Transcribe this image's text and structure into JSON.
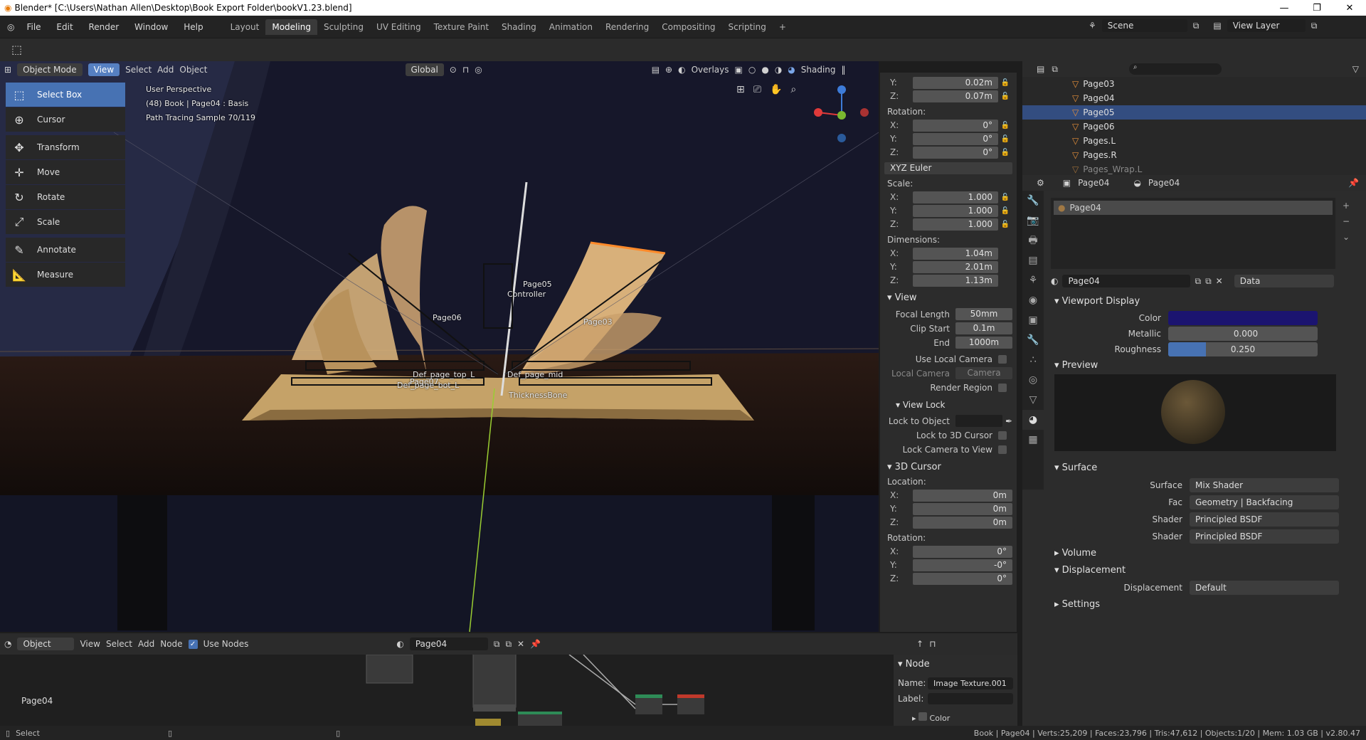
{
  "titlebar": {
    "text": "Blender* [C:\\Users\\Nathan Allen\\Desktop\\Book Export Folder\\bookV1.23.blend]",
    "minimize": "—",
    "maximize": "❐",
    "close": "✕"
  },
  "menus": [
    "File",
    "Edit",
    "Render",
    "Window",
    "Help"
  ],
  "workspaces": [
    "Layout",
    "Modeling",
    "Sculpting",
    "UV Editing",
    "Texture Paint",
    "Shading",
    "Animation",
    "Rendering",
    "Compositing",
    "Scripting"
  ],
  "active_workspace": "Modeling",
  "scene": {
    "label": "Scene",
    "view_layer": "View Layer"
  },
  "viewport_header": {
    "mode": "Object Mode",
    "menus": [
      "View",
      "Select",
      "Add",
      "Object"
    ],
    "transform": "Global",
    "overlays": "Overlays",
    "shading": "Shading"
  },
  "viewport_info": {
    "line1": "User Perspective",
    "line2": "(48) Book | Page04 : Basis",
    "line3": "Path Tracing Sample 70/119"
  },
  "tools": [
    "Select Box",
    "Cursor",
    "Transform",
    "Move",
    "Rotate",
    "Scale",
    "Annotate",
    "Measure"
  ],
  "scene_labels": {
    "page05": "Page05",
    "controller": "Controller",
    "page06": "Page06",
    "page03": "Page03",
    "thick": "ThicknessBone",
    "def_top": "Def_page_top_L",
    "def_bot": "Def_page_bot_L",
    "page07": "Page07",
    "def_page": "Def_page_mid"
  },
  "npanel": {
    "loc_y": {
      "k": "Y:",
      "v": "0.02m"
    },
    "loc_z": {
      "k": "Z:",
      "v": "0.07m"
    },
    "rotation_label": "Rotation:",
    "rotation": [
      {
        "k": "X:",
        "v": "0°"
      },
      {
        "k": "Y:",
        "v": "0°"
      },
      {
        "k": "Z:",
        "v": "0°"
      }
    ],
    "euler": "XYZ Euler",
    "scale_label": "Scale:",
    "scale": [
      {
        "k": "X:",
        "v": "1.000"
      },
      {
        "k": "Y:",
        "v": "1.000"
      },
      {
        "k": "Z:",
        "v": "1.000"
      }
    ],
    "dim_label": "Dimensions:",
    "dims": [
      {
        "k": "X:",
        "v": "1.04m"
      },
      {
        "k": "Y:",
        "v": "2.01m"
      },
      {
        "k": "Z:",
        "v": "1.13m"
      }
    ],
    "view_sect": "View",
    "focal_k": "Focal Length",
    "focal_v": "50mm",
    "clip_start_k": "Clip Start",
    "clip_start_v": "0.1m",
    "end_k": "End",
    "end_v": "1000m",
    "use_local_camera": "Use Local Camera",
    "local_camera_k": "Local Camera",
    "local_camera_v": "Camera",
    "render_region": "Render Region",
    "view_lock_sect": "View Lock",
    "lock_to_object": "Lock to Object",
    "lock_3d_cursor": "Lock to 3D Cursor",
    "lock_camera": "Lock Camera to View",
    "cursor_sect": "3D Cursor",
    "location_label": "Location:",
    "cursor_loc": [
      {
        "k": "X:",
        "v": "0m"
      },
      {
        "k": "Y:",
        "v": "0m"
      },
      {
        "k": "Z:",
        "v": "0m"
      }
    ],
    "cursor_rot_label": "Rotation:",
    "cursor_rot": [
      {
        "k": "X:",
        "v": "0°"
      },
      {
        "k": "Y:",
        "v": "-0°"
      },
      {
        "k": "Z:",
        "v": "0°"
      }
    ]
  },
  "outliner": [
    "Page03",
    "Page04",
    "Page05",
    "Page06",
    "Pages.L",
    "Pages.R",
    "Pages_Wrap.L"
  ],
  "outliner_selected": "Page05",
  "props": {
    "object": "Page04",
    "material": "Page04",
    "slot": "Page04",
    "datablock": "Page04",
    "data": "Data",
    "viewport_display": "Viewport Display",
    "color_k": "Color",
    "metallic_k": "Metallic",
    "metallic_v": "0.000",
    "roughness_k": "Roughness",
    "roughness_v": "0.250",
    "roughness_fraction": 0.25,
    "color_hex": "#1b1470",
    "preview": "Preview",
    "surface_sect": "Surface",
    "surface_k": "Surface",
    "surface_v": "Mix Shader",
    "fac_k": "Fac",
    "fac_v": "Geometry | Backfacing",
    "shader_k": "Shader",
    "shader1_v": "Principled BSDF",
    "shader2_v": "Principled BSDF",
    "volume": "Volume",
    "displacement_sect": "Displacement",
    "displacement_k": "Displacement",
    "displacement_v": "Default",
    "settings": "Settings"
  },
  "node_editor": {
    "type": "Object",
    "menus": [
      "View",
      "Select",
      "Add",
      "Node"
    ],
    "use_nodes": "Use Nodes",
    "material": "Page04",
    "label": "Page04",
    "panel_title": "Node",
    "name_k": "Name:",
    "name_v": "Image Texture.001",
    "label_k": "Label:",
    "color": "Color"
  },
  "status": {
    "left": "Select",
    "right": "Book | Page04 | Verts:25,209 | Faces:23,796 | Tris:47,612 | Objects:1/20 | Mem: 1.03 GB | v2.80.47"
  }
}
